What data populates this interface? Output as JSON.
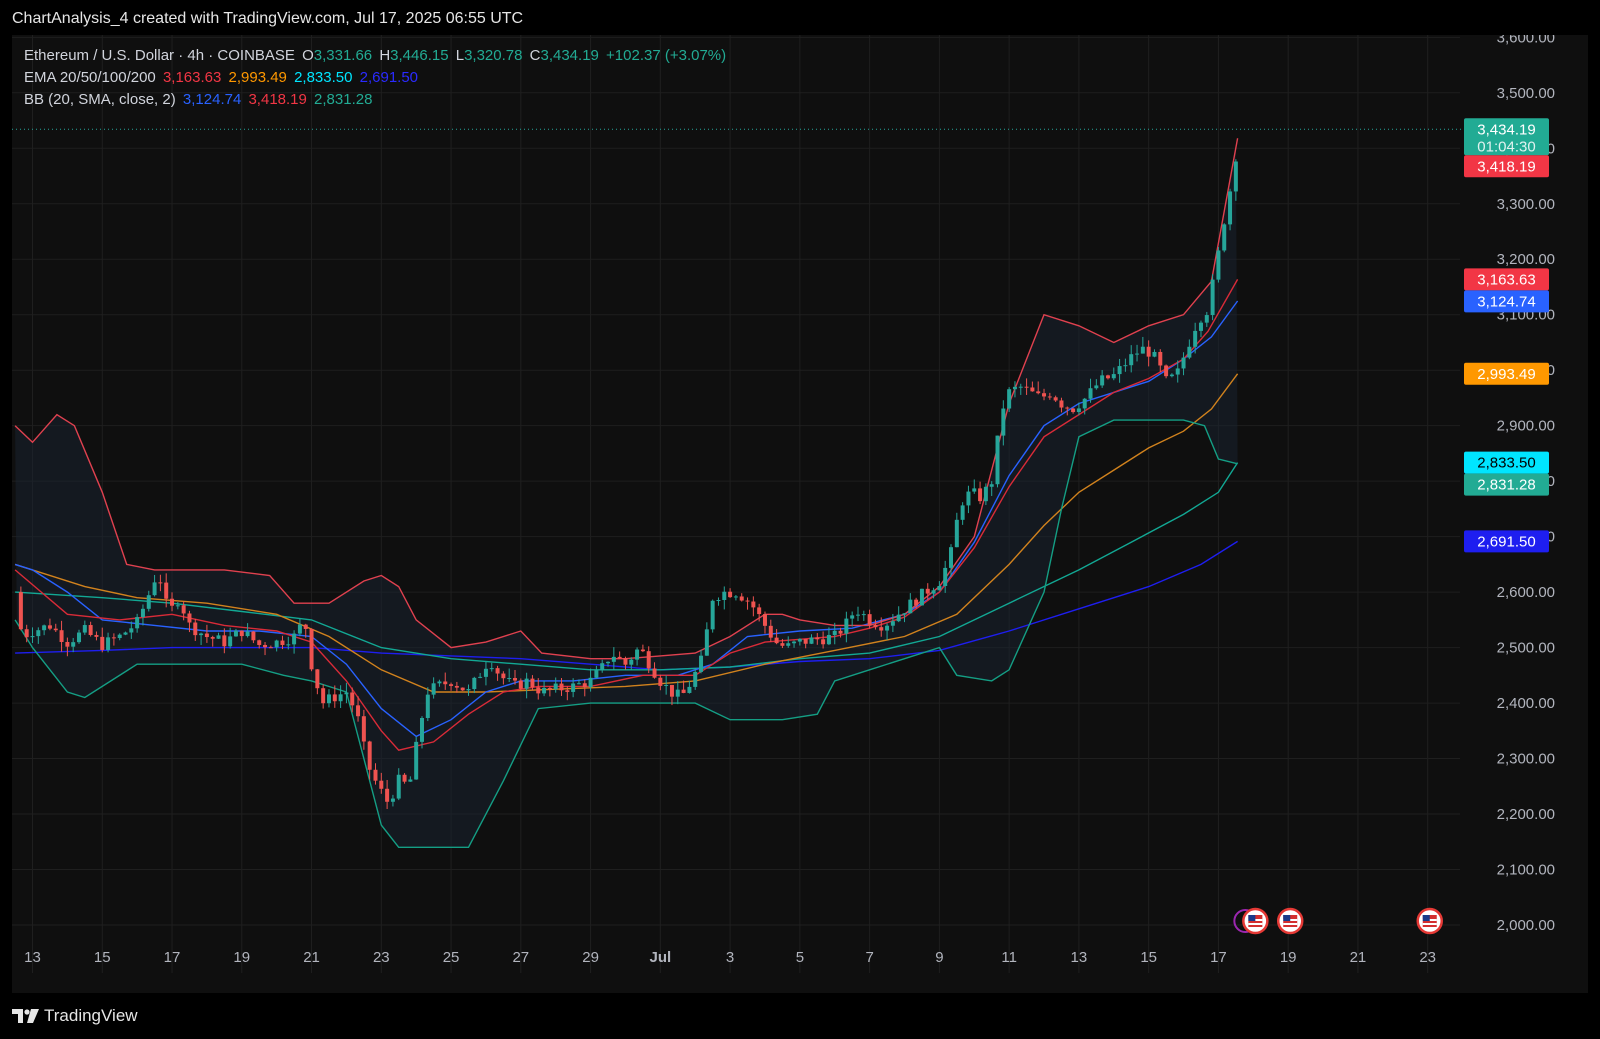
{
  "header": {
    "title": "ChartAnalysis_4 created with TradingView.com, Jul 17, 2025 06:55 UTC"
  },
  "legend": {
    "symbol": "Ethereum / U.S. Dollar · 4h · COINBASE",
    "open_label": "O",
    "open": "3,331.66",
    "high_label": "H",
    "high": "3,446.15",
    "low_label": "L",
    "low": "3,320.78",
    "close_label": "C",
    "close": "3,434.19",
    "change": "+102.37 (+3.07%)",
    "ema_label": "EMA 20/50/100/200",
    "ema20": "3,163.63",
    "ema50": "2,993.49",
    "ema100": "2,833.50",
    "ema200": "2,691.50",
    "bb_label": "BB (20, SMA, close, 2)",
    "bb_basis": "3,124.74",
    "bb_upper": "3,418.19",
    "bb_lower": "2,831.28"
  },
  "footer": {
    "brand": "TradingView"
  },
  "colors": {
    "up": "#26a69a",
    "down": "#ef5350",
    "ema20": "#f23645",
    "ema50": "#ff9800",
    "ema100": "#00e5ff",
    "ema200": "#1e1ef0",
    "bb_basis": "#2962ff",
    "bb_upper": "#f23645",
    "bb_lower": "#089981",
    "text": "#d1d4dc",
    "grid": "#1f1f1f"
  },
  "chart_data": {
    "type": "candlestick",
    "symbol": "ETH/USD",
    "interval": "4h",
    "ylim": [
      2000,
      3600
    ],
    "yticks": [
      2000,
      2100,
      2200,
      2300,
      2400,
      2500,
      2600,
      2700,
      2800,
      2900,
      3000,
      3100,
      3200,
      3300,
      3400,
      3500,
      3600
    ],
    "ytick_labels": [
      "2,000.00",
      "2,100.00",
      "2,200.00",
      "2,300.00",
      "2,400.00",
      "2,500.00",
      "2,600.00",
      "2,700.00",
      "2,800.00",
      "2,900.00",
      "3,000.00",
      "3,100.00",
      "3,200.00",
      "3,300.00",
      "3,400.00",
      "3,500.00",
      "3,600.00"
    ],
    "xticks": [
      {
        "day": 0,
        "label": "13"
      },
      {
        "day": 2,
        "label": "15"
      },
      {
        "day": 4,
        "label": "17"
      },
      {
        "day": 6,
        "label": "19"
      },
      {
        "day": 8,
        "label": "21"
      },
      {
        "day": 10,
        "label": "23"
      },
      {
        "day": 12,
        "label": "25"
      },
      {
        "day": 14,
        "label": "27"
      },
      {
        "day": 16,
        "label": "29"
      },
      {
        "day": 18,
        "label": "Jul"
      },
      {
        "day": 20,
        "label": "3"
      },
      {
        "day": 22,
        "label": "5"
      },
      {
        "day": 24,
        "label": "7"
      },
      {
        "day": 26,
        "label": "9"
      },
      {
        "day": 28,
        "label": "11"
      },
      {
        "day": 30,
        "label": "13"
      },
      {
        "day": 32,
        "label": "15"
      },
      {
        "day": 34,
        "label": "17"
      },
      {
        "day": 36,
        "label": "19"
      },
      {
        "day": 38,
        "label": "21"
      },
      {
        "day": 40,
        "label": "23"
      }
    ],
    "x_range_days": [
      -0.55,
      40.8
    ],
    "close_anchors": [
      [
        -0.5,
        2600
      ],
      [
        -0.3,
        2520
      ],
      [
        0,
        2530
      ],
      [
        0.5,
        2540
      ],
      [
        1,
        2510
      ],
      [
        1.5,
        2530
      ],
      [
        2,
        2505
      ],
      [
        2.5,
        2520
      ],
      [
        3,
        2545
      ],
      [
        3.3,
        2590
      ],
      [
        3.6,
        2640
      ],
      [
        3.9,
        2560
      ],
      [
        4.2,
        2590
      ],
      [
        4.5,
        2540
      ],
      [
        5,
        2520
      ],
      [
        5.5,
        2510
      ],
      [
        6,
        2530
      ],
      [
        6.5,
        2505
      ],
      [
        7,
        2510
      ],
      [
        7.5,
        2520
      ],
      [
        7.8,
        2550
      ],
      [
        8,
        2470
      ],
      [
        8.3,
        2400
      ],
      [
        8.6,
        2410
      ],
      [
        9,
        2420
      ],
      [
        9.3,
        2380
      ],
      [
        9.6,
        2290
      ],
      [
        9.9,
        2250
      ],
      [
        10.2,
        2220
      ],
      [
        10.5,
        2260
      ],
      [
        10.8,
        2250
      ],
      [
        11,
        2320
      ],
      [
        11.3,
        2420
      ],
      [
        11.6,
        2430
      ],
      [
        12,
        2440
      ],
      [
        12.5,
        2420
      ],
      [
        12.8,
        2450
      ],
      [
        13.1,
        2480
      ],
      [
        13.4,
        2450
      ],
      [
        13.8,
        2430
      ],
      [
        14.2,
        2440
      ],
      [
        14.6,
        2420
      ],
      [
        15,
        2425
      ],
      [
        15.5,
        2430
      ],
      [
        16,
        2440
      ],
      [
        16.3,
        2460
      ],
      [
        16.6,
        2490
      ],
      [
        17,
        2470
      ],
      [
        17.4,
        2500
      ],
      [
        17.7,
        2470
      ],
      [
        18,
        2440
      ],
      [
        18.3,
        2420
      ],
      [
        18.6,
        2410
      ],
      [
        18.9,
        2440
      ],
      [
        19.2,
        2480
      ],
      [
        19.5,
        2590
      ],
      [
        19.8,
        2600
      ],
      [
        20.2,
        2600
      ],
      [
        20.6,
        2580
      ],
      [
        21,
        2540
      ],
      [
        21.3,
        2510
      ],
      [
        21.6,
        2500
      ],
      [
        22,
        2510
      ],
      [
        22.5,
        2515
      ],
      [
        23,
        2520
      ],
      [
        23.3,
        2540
      ],
      [
        23.6,
        2570
      ],
      [
        24,
        2550
      ],
      [
        24.4,
        2540
      ],
      [
        24.8,
        2560
      ],
      [
        25.2,
        2580
      ],
      [
        25.6,
        2600
      ],
      [
        26,
        2620
      ],
      [
        26.3,
        2660
      ],
      [
        26.6,
        2760
      ],
      [
        26.9,
        2780
      ],
      [
        27.2,
        2770
      ],
      [
        27.5,
        2800
      ],
      [
        27.8,
        2930
      ],
      [
        28,
        2960
      ],
      [
        28.3,
        2970
      ],
      [
        28.6,
        2960
      ],
      [
        28.9,
        2950
      ],
      [
        29.2,
        2960
      ],
      [
        29.5,
        2940
      ],
      [
        29.8,
        2930
      ],
      [
        30.2,
        2950
      ],
      [
        30.6,
        2980
      ],
      [
        31,
        2990
      ],
      [
        31.3,
        3010
      ],
      [
        31.6,
        3030
      ],
      [
        31.9,
        3040
      ],
      [
        32.2,
        3020
      ],
      [
        32.5,
        2980
      ],
      [
        32.8,
        2990
      ],
      [
        33.1,
        3040
      ],
      [
        33.4,
        3090
      ],
      [
        33.7,
        3110
      ],
      [
        34,
        3210
      ],
      [
        34.3,
        3320
      ],
      [
        34.45,
        3340
      ],
      [
        34.55,
        3434.19
      ]
    ],
    "ema20": [
      [
        -0.5,
        2640
      ],
      [
        1,
        2560
      ],
      [
        2.5,
        2550
      ],
      [
        4,
        2560
      ],
      [
        5.5,
        2540
      ],
      [
        7,
        2530
      ],
      [
        8,
        2510
      ],
      [
        9,
        2440
      ],
      [
        10,
        2350
      ],
      [
        10.5,
        2315
      ],
      [
        11.5,
        2330
      ],
      [
        12.5,
        2380
      ],
      [
        13.5,
        2420
      ],
      [
        14.5,
        2430
      ],
      [
        16,
        2430
      ],
      [
        17.5,
        2450
      ],
      [
        19,
        2450
      ],
      [
        20,
        2490
      ],
      [
        21,
        2510
      ],
      [
        22,
        2515
      ],
      [
        23,
        2520
      ],
      [
        24,
        2535
      ],
      [
        25,
        2555
      ],
      [
        26,
        2600
      ],
      [
        27,
        2680
      ],
      [
        28,
        2790
      ],
      [
        29,
        2880
      ],
      [
        30,
        2920
      ],
      [
        31,
        2960
      ],
      [
        32,
        2985
      ],
      [
        33,
        3020
      ],
      [
        33.7,
        3070
      ],
      [
        34.55,
        3163.63
      ]
    ],
    "ema50": [
      [
        -0.5,
        2650
      ],
      [
        1.5,
        2610
      ],
      [
        3,
        2590
      ],
      [
        5,
        2580
      ],
      [
        7,
        2560
      ],
      [
        8.5,
        2520
      ],
      [
        10,
        2460
      ],
      [
        11.5,
        2420
      ],
      [
        13,
        2420
      ],
      [
        15,
        2425
      ],
      [
        17,
        2430
      ],
      [
        19,
        2440
      ],
      [
        21,
        2470
      ],
      [
        23,
        2495
      ],
      [
        25,
        2520
      ],
      [
        26.5,
        2560
      ],
      [
        28,
        2650
      ],
      [
        29,
        2720
      ],
      [
        30,
        2780
      ],
      [
        31,
        2820
      ],
      [
        32,
        2860
      ],
      [
        33,
        2890
      ],
      [
        33.8,
        2930
      ],
      [
        34.55,
        2993.49
      ]
    ],
    "ema100": [
      [
        -0.5,
        2600
      ],
      [
        2,
        2590
      ],
      [
        4,
        2580
      ],
      [
        6,
        2565
      ],
      [
        8,
        2550
      ],
      [
        10,
        2500
      ],
      [
        12,
        2480
      ],
      [
        14,
        2470
      ],
      [
        16,
        2460
      ],
      [
        18,
        2460
      ],
      [
        20,
        2465
      ],
      [
        22,
        2480
      ],
      [
        24,
        2490
      ],
      [
        26,
        2520
      ],
      [
        28,
        2580
      ],
      [
        30,
        2640
      ],
      [
        31.5,
        2690
      ],
      [
        33,
        2740
      ],
      [
        34,
        2780
      ],
      [
        34.55,
        2833.5
      ]
    ],
    "ema200": [
      [
        -0.5,
        2490
      ],
      [
        2,
        2495
      ],
      [
        4,
        2500
      ],
      [
        6,
        2500
      ],
      [
        8,
        2500
      ],
      [
        10,
        2490
      ],
      [
        12,
        2485
      ],
      [
        14,
        2480
      ],
      [
        16,
        2470
      ],
      [
        18,
        2460
      ],
      [
        20,
        2465
      ],
      [
        22,
        2475
      ],
      [
        24,
        2480
      ],
      [
        26,
        2495
      ],
      [
        28,
        2530
      ],
      [
        30,
        2570
      ],
      [
        32,
        2610
      ],
      [
        33.5,
        2650
      ],
      [
        34.55,
        2691.5
      ]
    ],
    "bb_basis": [
      [
        -0.5,
        2650
      ],
      [
        0,
        2640
      ],
      [
        1,
        2600
      ],
      [
        2,
        2550
      ],
      [
        3.5,
        2540
      ],
      [
        5,
        2530
      ],
      [
        6.5,
        2530
      ],
      [
        8,
        2520
      ],
      [
        9,
        2470
      ],
      [
        10,
        2390
      ],
      [
        11,
        2340
      ],
      [
        12,
        2370
      ],
      [
        13,
        2420
      ],
      [
        14,
        2440
      ],
      [
        15.5,
        2440
      ],
      [
        17,
        2450
      ],
      [
        18.5,
        2450
      ],
      [
        19.5,
        2470
      ],
      [
        20.5,
        2520
      ],
      [
        22,
        2530
      ],
      [
        23.5,
        2535
      ],
      [
        25,
        2560
      ],
      [
        26,
        2600
      ],
      [
        27,
        2690
      ],
      [
        28,
        2810
      ],
      [
        29,
        2900
      ],
      [
        30,
        2940
      ],
      [
        31,
        2960
      ],
      [
        32,
        2980
      ],
      [
        33,
        3020
      ],
      [
        33.8,
        3060
      ],
      [
        34.55,
        3124.74
      ]
    ],
    "bb_upper": [
      [
        -0.5,
        2900
      ],
      [
        0,
        2870
      ],
      [
        0.7,
        2920
      ],
      [
        1.2,
        2900
      ],
      [
        2,
        2780
      ],
      [
        2.7,
        2650
      ],
      [
        3.5,
        2640
      ],
      [
        4.5,
        2640
      ],
      [
        5.5,
        2640
      ],
      [
        6.8,
        2630
      ],
      [
        7.5,
        2580
      ],
      [
        8.5,
        2580
      ],
      [
        9.5,
        2620
      ],
      [
        10,
        2630
      ],
      [
        10.5,
        2610
      ],
      [
        11,
        2550
      ],
      [
        12,
        2500
      ],
      [
        13,
        2510
      ],
      [
        14,
        2530
      ],
      [
        14.6,
        2490
      ],
      [
        16,
        2480
      ],
      [
        17,
        2480
      ],
      [
        18,
        2485
      ],
      [
        19,
        2490
      ],
      [
        20,
        2520
      ],
      [
        21,
        2560
      ],
      [
        21.5,
        2560
      ],
      [
        22,
        2550
      ],
      [
        23,
        2540
      ],
      [
        24,
        2540
      ],
      [
        25,
        2560
      ],
      [
        26,
        2610
      ],
      [
        27,
        2700
      ],
      [
        28,
        2940
      ],
      [
        29,
        3100
      ],
      [
        30,
        3080
      ],
      [
        31,
        3050
      ],
      [
        32,
        3080
      ],
      [
        33,
        3100
      ],
      [
        33.8,
        3160
      ],
      [
        34.55,
        3418.19
      ]
    ],
    "bb_lower": [
      [
        -0.5,
        2550
      ],
      [
        0,
        2500
      ],
      [
        1,
        2420
      ],
      [
        1.5,
        2410
      ],
      [
        3,
        2470
      ],
      [
        4.5,
        2470
      ],
      [
        6,
        2470
      ],
      [
        7.2,
        2450
      ],
      [
        8,
        2440
      ],
      [
        9,
        2420
      ],
      [
        10,
        2180
      ],
      [
        10.5,
        2140
      ],
      [
        11.5,
        2140
      ],
      [
        12.5,
        2140
      ],
      [
        13.5,
        2260
      ],
      [
        14.5,
        2390
      ],
      [
        16,
        2400
      ],
      [
        17.5,
        2400
      ],
      [
        19,
        2400
      ],
      [
        20,
        2370
      ],
      [
        21.5,
        2370
      ],
      [
        22.5,
        2380
      ],
      [
        23,
        2440
      ],
      [
        24,
        2460
      ],
      [
        25,
        2480
      ],
      [
        26,
        2500
      ],
      [
        26.5,
        2450
      ],
      [
        27.5,
        2440
      ],
      [
        28,
        2460
      ],
      [
        29,
        2600
      ],
      [
        29.5,
        2750
      ],
      [
        30,
        2880
      ],
      [
        31,
        2910
      ],
      [
        32,
        2910
      ],
      [
        33,
        2910
      ],
      [
        33.6,
        2900
      ],
      [
        34,
        2840
      ],
      [
        34.55,
        2831.28
      ]
    ],
    "price_tags": [
      {
        "value": 3434.19,
        "label": "3,434.19",
        "sub": "01:04:30",
        "color": "#22ab94"
      },
      {
        "value": 3418.19,
        "label": "3,418.19",
        "color": "#f23645"
      },
      {
        "value": 3163.63,
        "label": "3,163.63",
        "color": "#f23645"
      },
      {
        "value": 3124.74,
        "label": "3,124.74",
        "color": "#2962ff"
      },
      {
        "value": 2993.49,
        "label": "2,993.49",
        "color": "#ff9800"
      },
      {
        "value": 2833.5,
        "label": "2,833.50",
        "color": "#00e5ff",
        "text_color": "#000000"
      },
      {
        "value": 2831.28,
        "label": "2,831.28",
        "color": "#22ab94"
      },
      {
        "value": 2691.5,
        "label": "2,691.50",
        "color": "#1e1ef0"
      }
    ],
    "event_markers": [
      {
        "day": 34.6,
        "type": "flag"
      },
      {
        "day": 35.6,
        "type": "flag"
      },
      {
        "day": 39.6,
        "type": "flag"
      }
    ]
  }
}
